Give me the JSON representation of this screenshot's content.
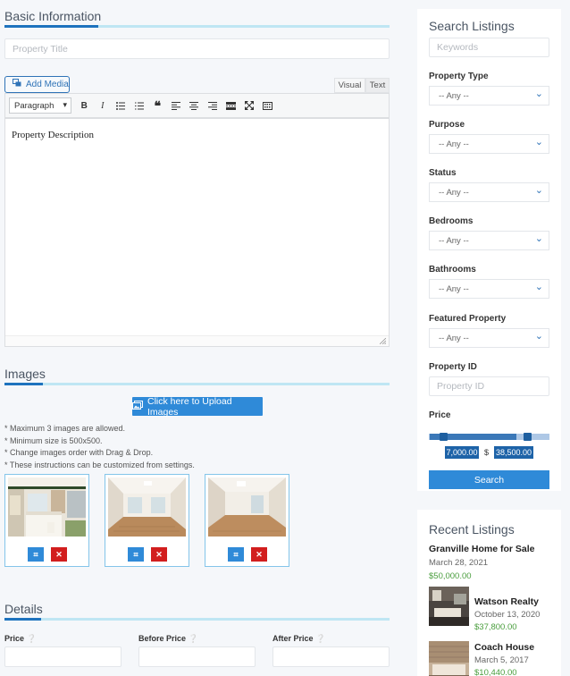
{
  "basic": {
    "title": "Basic Information",
    "property_title_placeholder": "Property Title",
    "add_media": "Add Media",
    "tab_visual": "Visual",
    "tab_text": "Text",
    "format_select": "Paragraph",
    "description_placeholder": "Property Description"
  },
  "images": {
    "title": "Images",
    "upload_label": "Click here to Upload Images",
    "notes": [
      "* Maximum 3 images are allowed.",
      "* Minimum size is 500x500.",
      "* Change images order with Drag & Drop.",
      "* These instructions can be customized from settings."
    ]
  },
  "details": {
    "title": "Details",
    "price_label": "Price",
    "before_price_label": "Before Price",
    "after_price_label": "After Price"
  },
  "search": {
    "title": "Search Listings",
    "keywords_placeholder": "Keywords",
    "property_type_label": "Property Type",
    "purpose_label": "Purpose",
    "status_label": "Status",
    "bedrooms_label": "Bedrooms",
    "bathrooms_label": "Bathrooms",
    "featured_label": "Featured Property",
    "property_id_label": "Property ID",
    "property_id_placeholder": "Property ID",
    "any_option": "-- Any --",
    "price_label": "Price",
    "price_min": "7,000.00",
    "price_currency": "$",
    "price_max": "38,500.00",
    "search_button": "Search"
  },
  "recent": {
    "title": "Recent Listings",
    "items": [
      {
        "title": "Granville Home for Sale",
        "date": "March 28, 2021",
        "price": "$50,000.00"
      },
      {
        "title": "Watson Realty",
        "date": "October 13, 2020",
        "price": "$37,800.00"
      },
      {
        "title": "Coach House",
        "date": "March 5, 2017",
        "price": "$10,440.00"
      }
    ]
  },
  "colors": {
    "accent": "#2f8ad8",
    "danger": "#d21e1e",
    "price_green": "#4a9e3e"
  }
}
